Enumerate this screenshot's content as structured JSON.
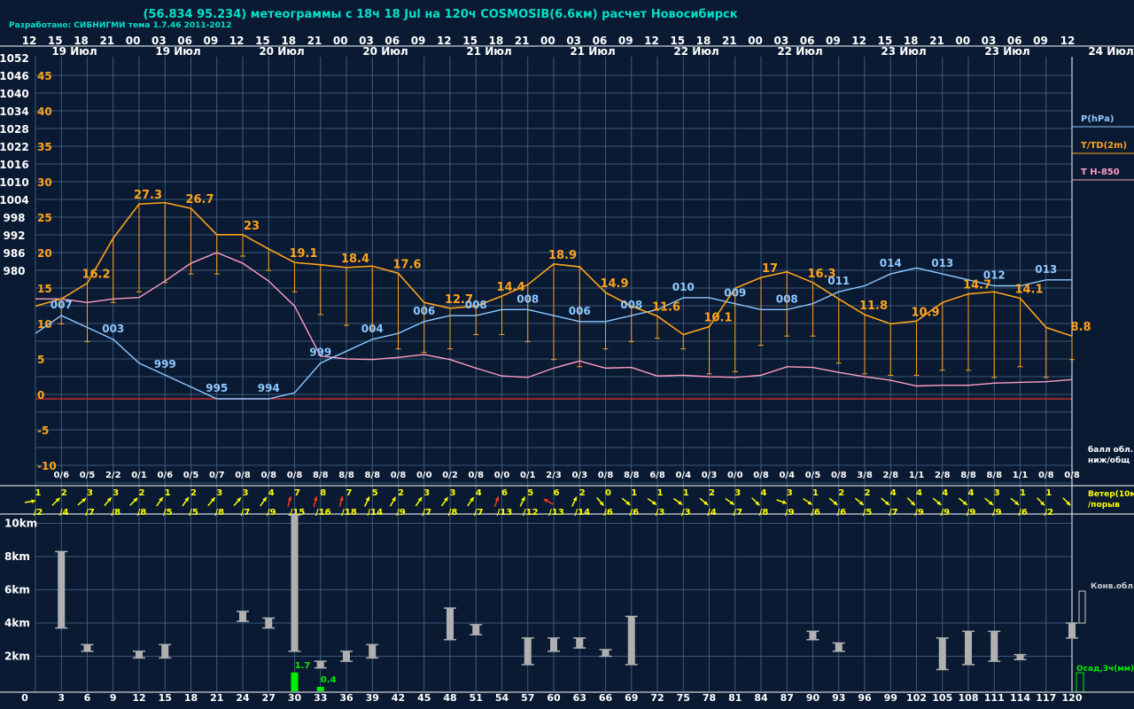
{
  "header": {
    "title": "(56.834 95.234) метеограммы с  18ч 18 Jul на 120ч COSMOSIB(6.6км) расчет Новосибирск",
    "credit": "Разработано: СИБНИГМИ тема 1.7.46 2011-2012"
  },
  "colors": {
    "background": "#0a1a33",
    "grid": "#4a6a8c",
    "pressure": "#8fc8ff",
    "temperature": "#ffa31a",
    "t850": "#ff9ec4",
    "wind": "#ffff00",
    "wind_strong": "#ff3a1a",
    "precip": "#00ee00",
    "cloud_bar": "#b0b0b0",
    "zero_line": "#c0302a",
    "title": "#00e0c8"
  },
  "time_axis": {
    "hours": [
      "12",
      "15",
      "18",
      "21",
      "00",
      "03",
      "06",
      "09",
      "12",
      "15",
      "18",
      "21",
      "00",
      "03",
      "06",
      "09",
      "12",
      "15",
      "18",
      "21",
      "00",
      "03",
      "06",
      "09",
      "12",
      "15",
      "18",
      "21",
      "00",
      "03",
      "06",
      "09",
      "12",
      "15",
      "18",
      "21",
      "00",
      "03",
      "06",
      "09",
      "12"
    ],
    "dates": [
      "19 Июл",
      "19 Июл",
      "20 Июл",
      "20 Июл",
      "21 Июл",
      "21 Июл",
      "22 Июл",
      "22 Июл",
      "23 Июл",
      "23 Июл"
    ],
    "end_date": "24 Июл",
    "forecast_hours": [
      "0",
      "3",
      "6",
      "9",
      "12",
      "15",
      "18",
      "21",
      "24",
      "27",
      "30",
      "33",
      "36",
      "39",
      "42",
      "45",
      "48",
      "51",
      "54",
      "57",
      "60",
      "63",
      "66",
      "69",
      "72",
      "75",
      "78",
      "81",
      "84",
      "87",
      "90",
      "93",
      "96",
      "99",
      "102",
      "105",
      "108",
      "111",
      "114",
      "117",
      "120"
    ]
  },
  "axes": {
    "pressure_ticks": [
      "1052",
      "1046",
      "1040",
      "1034",
      "1028",
      "1022",
      "1016",
      "1010",
      "1004",
      "998",
      "992",
      "986",
      "980"
    ],
    "temp_ticks": [
      "45",
      "40",
      "35",
      "30",
      "25",
      "20",
      "15",
      "10",
      "5",
      "0",
      "-5",
      "-10"
    ],
    "height_ticks": [
      "10km",
      "8km",
      "6km",
      "4km",
      "2km"
    ]
  },
  "legend": {
    "pressure": "P(hPa)",
    "temperature": "T/TD(2m)",
    "t850": "T H-850",
    "clouds": "балл обл.\nниж/общ",
    "wind": "Ветер(10м)\n/порыв",
    "conv": "Конв.обл.",
    "precip": "Осад,3ч(мм)"
  },
  "chart_data": {
    "type": "line",
    "x": [
      0,
      3,
      6,
      9,
      12,
      15,
      18,
      21,
      24,
      27,
      30,
      33,
      36,
      39,
      42,
      45,
      48,
      51,
      54,
      57,
      60,
      63,
      66,
      69,
      72,
      75,
      78,
      81,
      84,
      87,
      90,
      93,
      96,
      99,
      102,
      105,
      108,
      111,
      114,
      117,
      120
    ],
    "series": [
      {
        "name": "P(hPa)",
        "values": [
          1004,
          1007,
          1005,
          1003,
          999,
          997,
          995,
          993,
          993,
          993,
          994,
          999,
          1001,
          1003,
          1004,
          1006,
          1007,
          1007,
          1008,
          1008,
          1007,
          1006,
          1006,
          1007,
          1008,
          1010,
          1010,
          1009,
          1008,
          1008,
          1009,
          1011,
          1012,
          1014,
          1015,
          1014,
          1013,
          1012,
          1012,
          1013,
          1013
        ]
      },
      {
        "name": "T/TD(2m)",
        "values": [
          13,
          14,
          16.2,
          22.5,
          27.3,
          27.5,
          26.7,
          23,
          23,
          21,
          19.1,
          18.8,
          18.4,
          18.6,
          17.6,
          13.5,
          12.7,
          13,
          14.4,
          16,
          18.9,
          18.5,
          14.9,
          13,
          11.6,
          9,
          10.1,
          15.5,
          17,
          17.8,
          16.3,
          14,
          11.8,
          10.5,
          10.9,
          13.5,
          14.7,
          15,
          14.1,
          10,
          8.8
        ]
      },
      {
        "name": "TD",
        "values": [
          null,
          10.5,
          8,
          13.5,
          15,
          16.3,
          17.5,
          17.5,
          20,
          18,
          15,
          11.8,
          10.3,
          9.7,
          7,
          6.5,
          7,
          9,
          9,
          8,
          5.5,
          4.5,
          7,
          8,
          8.5,
          7,
          3.5,
          3.8,
          7.5,
          8.8,
          8.8,
          5,
          3.5,
          3.3,
          3.3,
          4,
          4,
          3,
          4.5,
          3,
          5.5
        ]
      },
      {
        "name": "T H-850",
        "values": [
          14,
          14,
          13.5,
          14,
          14.2,
          16.5,
          19,
          20.5,
          19,
          16.5,
          13,
          6,
          5.6,
          5.5,
          5.8,
          6.2,
          5.5,
          4.3,
          3.2,
          3,
          4.3,
          5.3,
          4.3,
          4.4,
          3.2,
          3.3,
          3.1,
          3,
          3.3,
          4.5,
          4.4,
          3.7,
          3.1,
          2.6,
          1.8,
          1.9,
          1.9,
          2.2,
          2.3,
          2.4,
          2.7
        ]
      }
    ],
    "t_labels": [
      {
        "h": 12,
        "text": "27.3"
      },
      {
        "h": 18,
        "text": "26.7"
      },
      {
        "h": 24,
        "text": "23"
      },
      {
        "h": 30,
        "text": "19.1"
      },
      {
        "h": 36,
        "text": "18.4"
      },
      {
        "h": 42,
        "text": "17.6"
      },
      {
        "h": 48,
        "text": "12.7"
      },
      {
        "h": 54,
        "text": "14.4"
      },
      {
        "h": 60,
        "text": "18.9"
      },
      {
        "h": 66,
        "text": "14.9"
      },
      {
        "h": 72,
        "text": "11.6"
      },
      {
        "h": 78,
        "text": "10.1"
      },
      {
        "h": 84,
        "text": "17"
      },
      {
        "h": 90,
        "text": "16.3"
      },
      {
        "h": 96,
        "text": "11.8"
      },
      {
        "h": 102,
        "text": "10.9"
      },
      {
        "h": 108,
        "text": "14.7"
      },
      {
        "h": 114,
        "text": "14.1"
      },
      {
        "h": 120,
        "text": "8.8"
      },
      {
        "h": 6,
        "text": "16.2"
      }
    ],
    "p_labels": [
      {
        "h": 3,
        "text": "007"
      },
      {
        "h": 9,
        "text": "003"
      },
      {
        "h": 15,
        "text": "999"
      },
      {
        "h": 21,
        "text": "995"
      },
      {
        "h": 27,
        "text": "994"
      },
      {
        "h": 33,
        "text": "999"
      },
      {
        "h": 39,
        "text": "004"
      },
      {
        "h": 45,
        "text": "006"
      },
      {
        "h": 51,
        "text": "008"
      },
      {
        "h": 57,
        "text": "008"
      },
      {
        "h": 63,
        "text": "006"
      },
      {
        "h": 69,
        "text": "008"
      },
      {
        "h": 75,
        "text": "010"
      },
      {
        "h": 81,
        "text": "009"
      },
      {
        "h": 87,
        "text": "008"
      },
      {
        "h": 93,
        "text": "011"
      },
      {
        "h": 99,
        "text": "014"
      },
      {
        "h": 105,
        "text": "013"
      },
      {
        "h": 111,
        "text": "012"
      },
      {
        "h": 117,
        "text": "013"
      }
    ],
    "clouds": [
      "",
      "0/6",
      "0/5",
      "2/2",
      "0/1",
      "0/6",
      "0/5",
      "0/7",
      "0/8",
      "0/8",
      "0/8",
      "8/8",
      "8/8",
      "8/8",
      "0/8",
      "0/0",
      "0/2",
      "0/8",
      "0/0",
      "0/1",
      "2/3",
      "0/3",
      "0/8",
      "8/8",
      "6/8",
      "0/4",
      "0/3",
      "0/0",
      "0/8",
      "0/4",
      "0/5",
      "0/8",
      "3/8",
      "2/8",
      "1/1",
      "2/8",
      "8/8",
      "8/8",
      "1/1",
      "0/8",
      "0/8"
    ],
    "wind_speed": [
      "1",
      "2",
      "3",
      "3",
      "2",
      "1",
      "2",
      "3",
      "3",
      "4",
      "7",
      "8",
      "7",
      "5",
      "2",
      "3",
      "3",
      "4",
      "6",
      "5",
      "6",
      "2",
      "0",
      "1",
      "1",
      "1",
      "2",
      "3",
      "4",
      "3",
      "1",
      "2",
      "2",
      "4",
      "4",
      "4",
      "4",
      "3",
      "1",
      "1",
      ""
    ],
    "wind_gust": [
      "/2",
      "/4",
      "/7",
      "/8",
      "/8",
      "/5",
      "/5",
      "/8",
      "/7",
      "/9",
      "/15",
      "/16",
      "/18",
      "/14",
      "/9",
      "/7",
      "/8",
      "/7",
      "/13",
      "/12",
      "/13",
      "/14",
      "/6",
      "/6",
      "/3",
      "/3",
      "/4",
      "/7",
      "/8",
      "/9",
      "/6",
      "/6",
      "/5",
      "/7",
      "/9",
      "/9",
      "/9",
      "/9",
      "/6",
      "/2",
      ""
    ],
    "wind_dir": [
      80,
      45,
      50,
      40,
      45,
      35,
      35,
      40,
      40,
      35,
      15,
      15,
      15,
      25,
      30,
      35,
      35,
      35,
      20,
      25,
      300,
      25,
      140,
      130,
      125,
      125,
      130,
      125,
      135,
      110,
      125,
      130,
      130,
      130,
      135,
      130,
      130,
      130,
      130,
      135,
      135
    ],
    "conv_clouds": [
      {
        "h": 3,
        "base": 3.7,
        "top": 8.3
      },
      {
        "h": 6,
        "base": 2.3,
        "top": 2.7
      },
      {
        "h": 12,
        "base": 1.9,
        "top": 2.3
      },
      {
        "h": 15,
        "base": 1.9,
        "top": 2.7
      },
      {
        "h": 24,
        "base": 4.1,
        "top": 4.7
      },
      {
        "h": 27,
        "base": 3.7,
        "top": 4.3
      },
      {
        "h": 30,
        "base": 2.3,
        "top": 10.5
      },
      {
        "h": 33,
        "base": 1.3,
        "top": 1.7
      },
      {
        "h": 36,
        "base": 1.7,
        "top": 2.3
      },
      {
        "h": 39,
        "base": 1.9,
        "top": 2.7
      },
      {
        "h": 48,
        "base": 3.0,
        "top": 4.9
      },
      {
        "h": 51,
        "base": 3.3,
        "top": 3.9
      },
      {
        "h": 57,
        "base": 1.5,
        "top": 3.1
      },
      {
        "h": 60,
        "base": 2.3,
        "top": 3.1
      },
      {
        "h": 63,
        "base": 2.5,
        "top": 3.1
      },
      {
        "h": 66,
        "base": 2.0,
        "top": 2.4
      },
      {
        "h": 69,
        "base": 1.5,
        "top": 4.4
      },
      {
        "h": 90,
        "base": 3.0,
        "top": 3.5
      },
      {
        "h": 93,
        "base": 2.3,
        "top": 2.8
      },
      {
        "h": 105,
        "base": 1.2,
        "top": 3.1
      },
      {
        "h": 108,
        "base": 1.5,
        "top": 3.5
      },
      {
        "h": 111,
        "base": 1.7,
        "top": 3.5
      },
      {
        "h": 114,
        "base": 1.8,
        "top": 2.1
      },
      {
        "h": 120,
        "base": 3.1,
        "top": 4.0
      }
    ],
    "precip": [
      {
        "h": 30,
        "value": 1.7,
        "label": "1.7"
      },
      {
        "h": 33,
        "value": 0.4,
        "label": "0.4"
      }
    ]
  }
}
